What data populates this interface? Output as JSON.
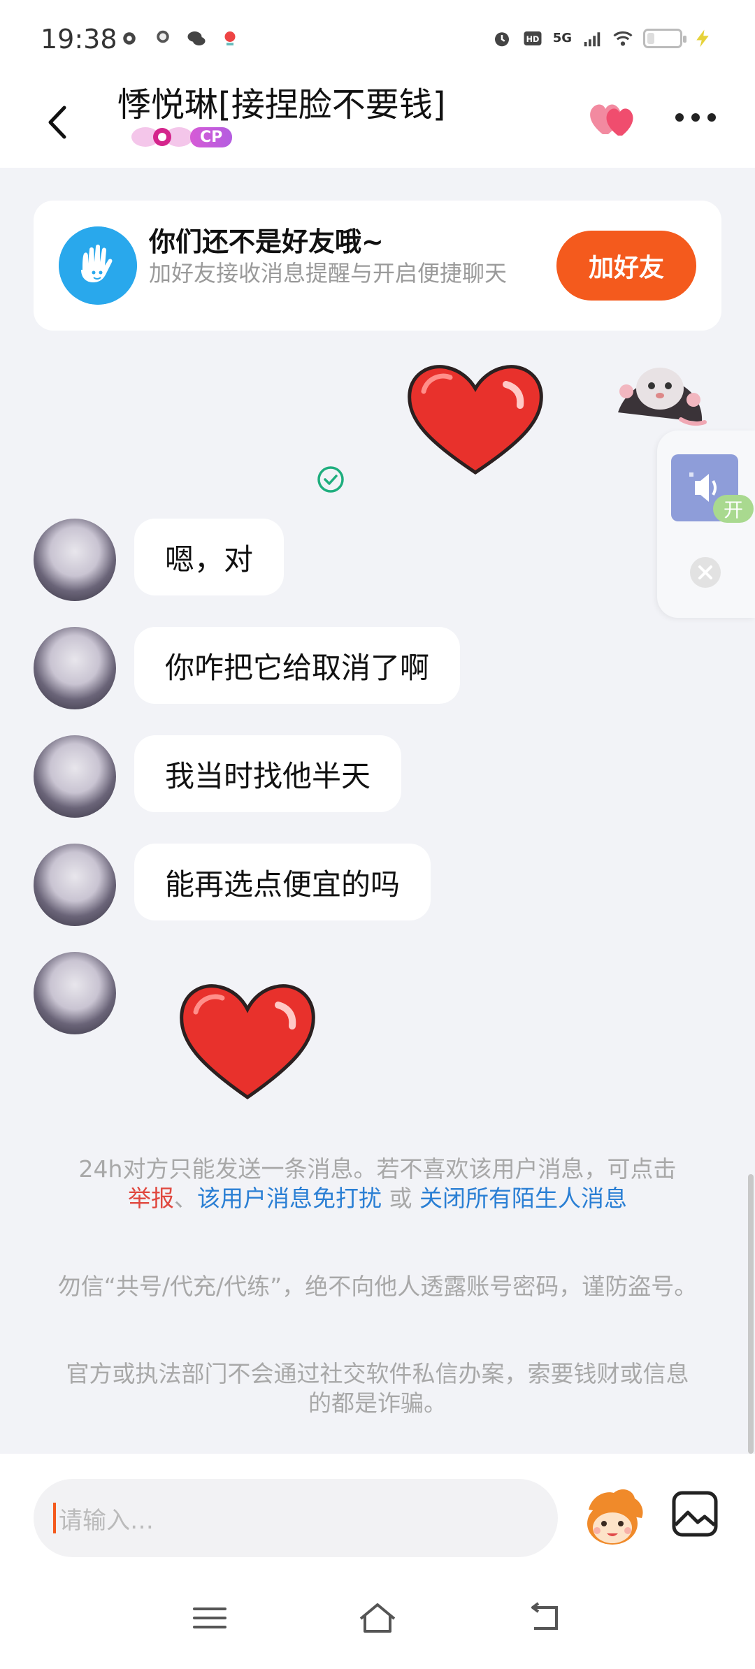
{
  "status_bar": {
    "time": "19:38",
    "network": "5G",
    "hd": "HD"
  },
  "header": {
    "title": "悸悦琳[接捏脸不要钱]",
    "badge": "CP"
  },
  "friend_card": {
    "title": "你们还不是好友哦~",
    "description": "加好友接收消息提醒与开启便捷聊天",
    "button": "加好友"
  },
  "side_float": {
    "tag": "开"
  },
  "messages": [
    {
      "text": "嗯，对"
    },
    {
      "text": "你咋把它给取消了啊"
    },
    {
      "text": "我当时找他半天"
    },
    {
      "text": "能再选点便宜的吗"
    }
  ],
  "notice": {
    "text": "24h对方只能发送一条消息。若不喜欢该用户消息，可点击",
    "report": "举报",
    "sep1": "、",
    "mute": "该用户消息免打扰",
    "or": " 或 ",
    "close_all": "关闭所有陌生人消息"
  },
  "tips": [
    "勿信“共号/代充/代练”，绝不向他人透露账号密码，谨防盗号。",
    "官方或执法部门不会通过社交软件私信办案，索要钱财或信息的都是诈骗。"
  ],
  "input": {
    "placeholder": "请输入…"
  },
  "icons": {
    "back": "chevron-left-icon",
    "more": "more-dots-icon",
    "emoji": "emoji-mascot-icon",
    "image": "image-icon"
  },
  "colors": {
    "accent": "#f45a1d",
    "link_blue": "#2a7fd4",
    "report_red": "#e0483f"
  }
}
